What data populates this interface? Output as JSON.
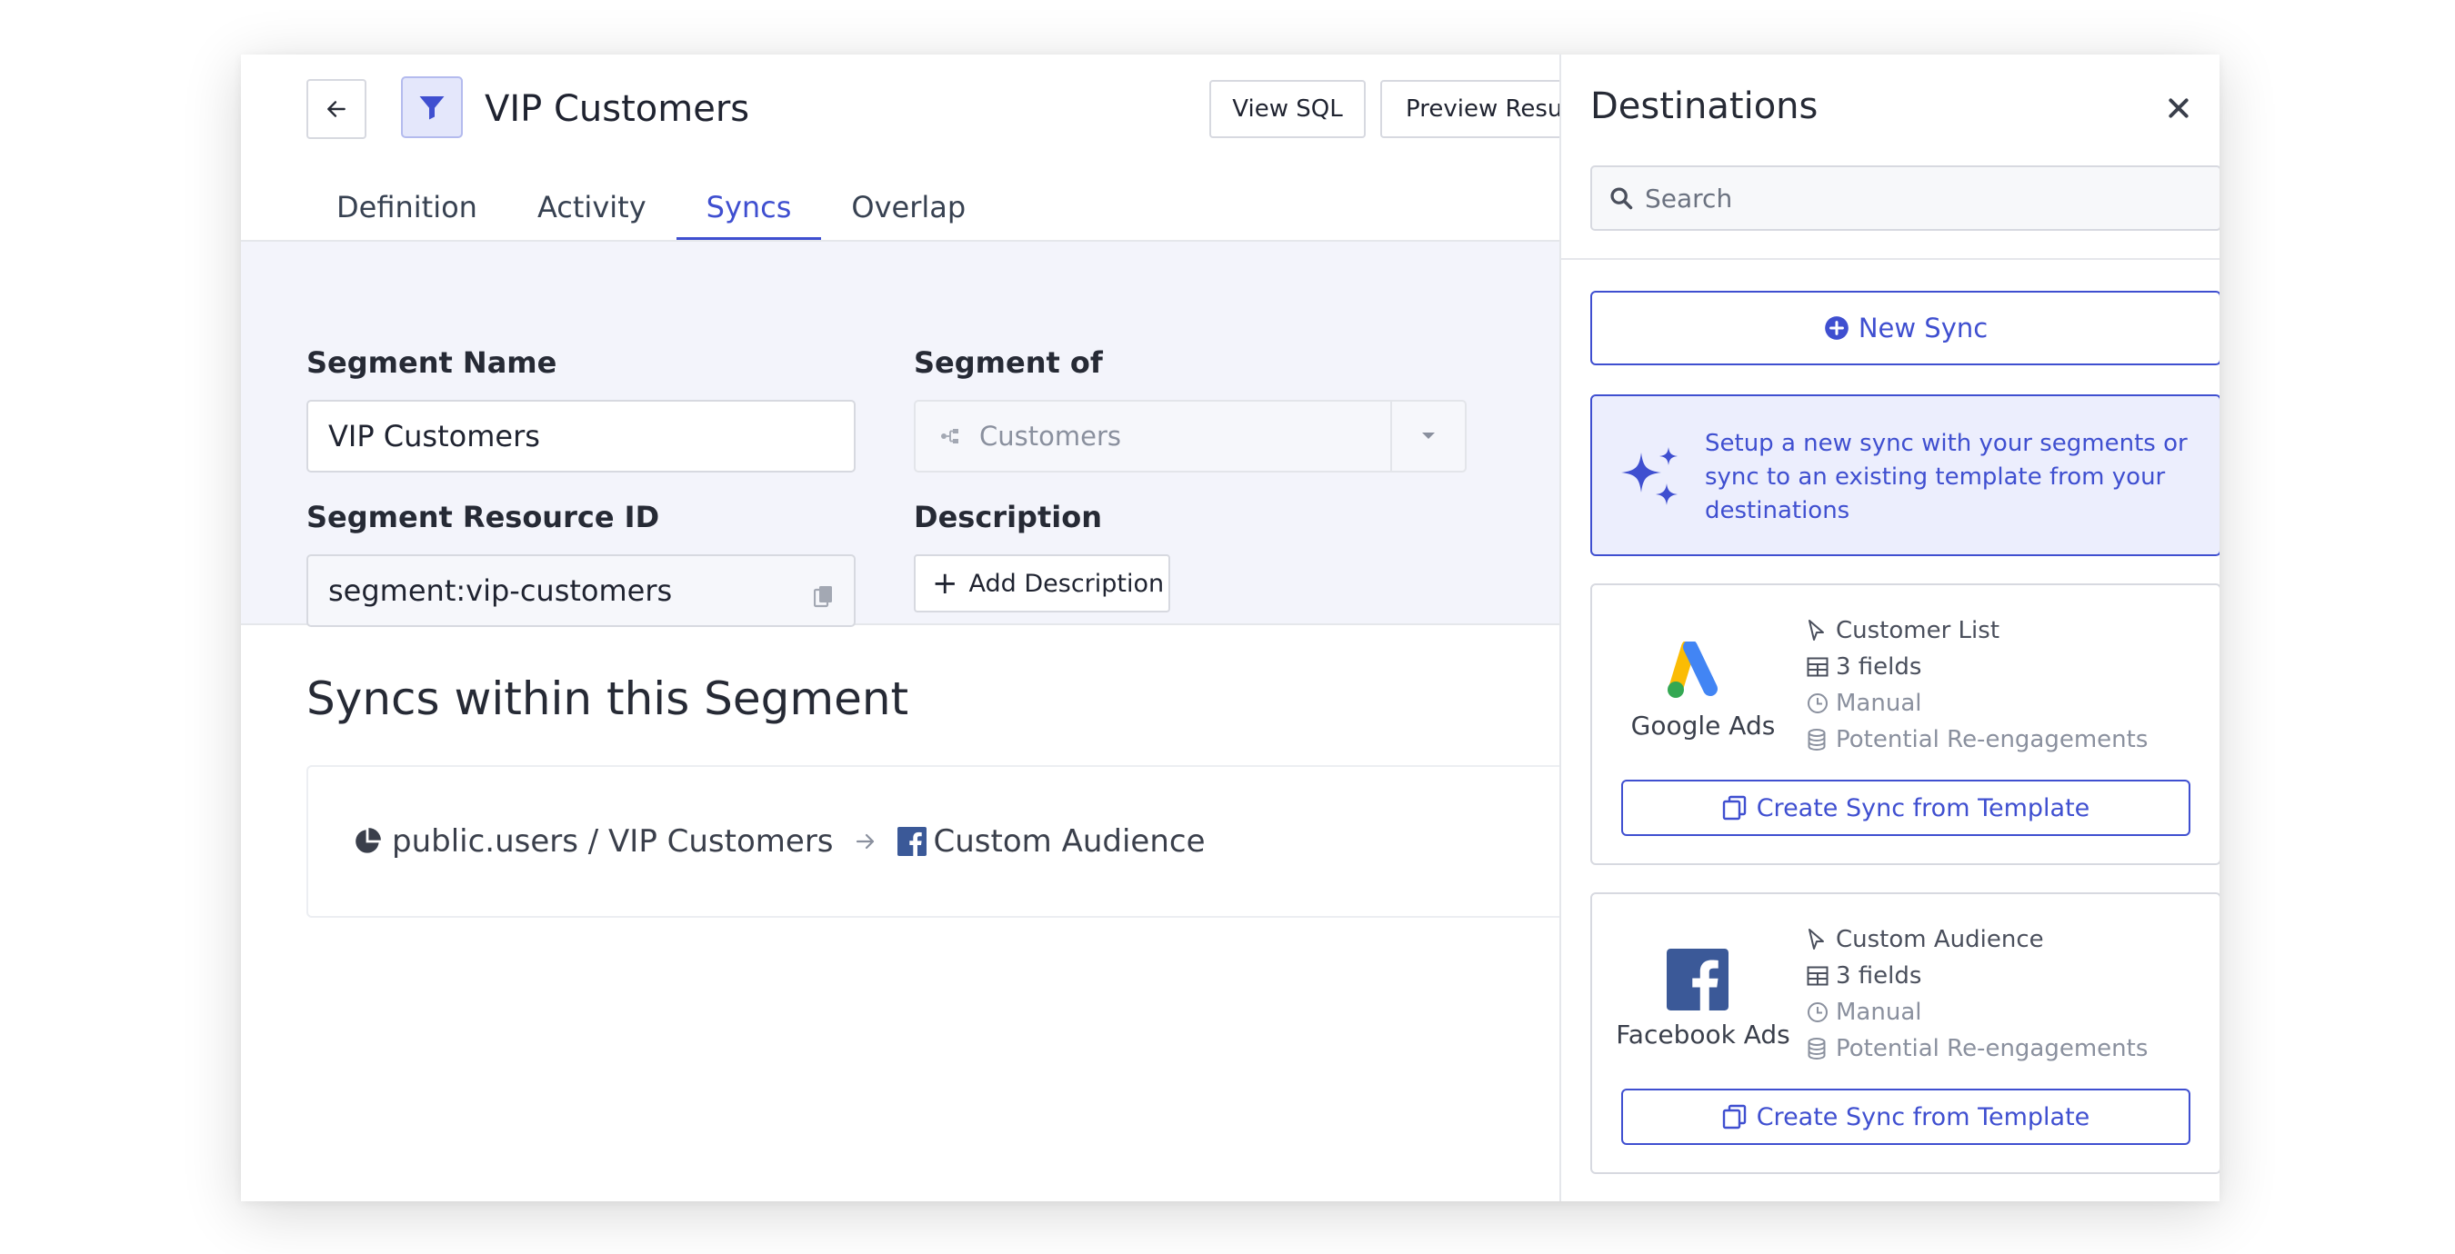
{
  "header": {
    "title": "VIP Customers",
    "view_sql": "View SQL",
    "preview_results": "Preview Results"
  },
  "tabs": [
    {
      "label": "Definition",
      "active": false
    },
    {
      "label": "Activity",
      "active": false
    },
    {
      "label": "Syncs",
      "active": true
    },
    {
      "label": "Overlap",
      "active": false
    }
  ],
  "form": {
    "segment_name_label": "Segment Name",
    "segment_name_value": "VIP Customers",
    "segment_of_label": "Segment of",
    "segment_of_value": "Customers",
    "resource_id_label": "Segment Resource ID",
    "resource_id_value": "segment:vip-customers",
    "description_label": "Description",
    "add_description": "Add Description"
  },
  "syncs": {
    "title": "Syncs within this Segment",
    "items": [
      {
        "source": "public.users / VIP Customers",
        "destination": "Custom Audience"
      }
    ]
  },
  "destinations": {
    "title": "Destinations",
    "search_placeholder": "Search",
    "new_sync": "New Sync",
    "info_text": "Setup a new sync with your segments or sync to an existing template from your destinations",
    "templates": [
      {
        "name": "Google Ads",
        "type": "Customer List",
        "fields": "3 fields",
        "schedule": "Manual",
        "model": "Potential Re-engagements",
        "button": "Create Sync from Template"
      },
      {
        "name": "Facebook Ads",
        "type": "Custom Audience",
        "fields": "3 fields",
        "schedule": "Manual",
        "model": "Potential Re-engagements",
        "button": "Create Sync from Template"
      }
    ]
  },
  "icons": {
    "back": "arrow-left-icon",
    "segment": "filter-icon",
    "segment_of": "model-graph-icon",
    "copy": "copy-icon",
    "sync_source": "pie-chart-icon",
    "sync_arrow": "arrow-right-icon",
    "close": "close-icon",
    "search": "search-icon",
    "new_sync": "plus-circle-icon",
    "info": "sparkles-icon",
    "type": "cursor-icon",
    "fields": "table-icon",
    "schedule": "clock-icon",
    "model": "database-icon",
    "template_button": "duplicate-icon"
  },
  "colors": {
    "accent": "#3f4fd0",
    "panel_background": "#f3f4fb",
    "info_background": "#eceefd",
    "facebook_blue": "#3b5998"
  }
}
